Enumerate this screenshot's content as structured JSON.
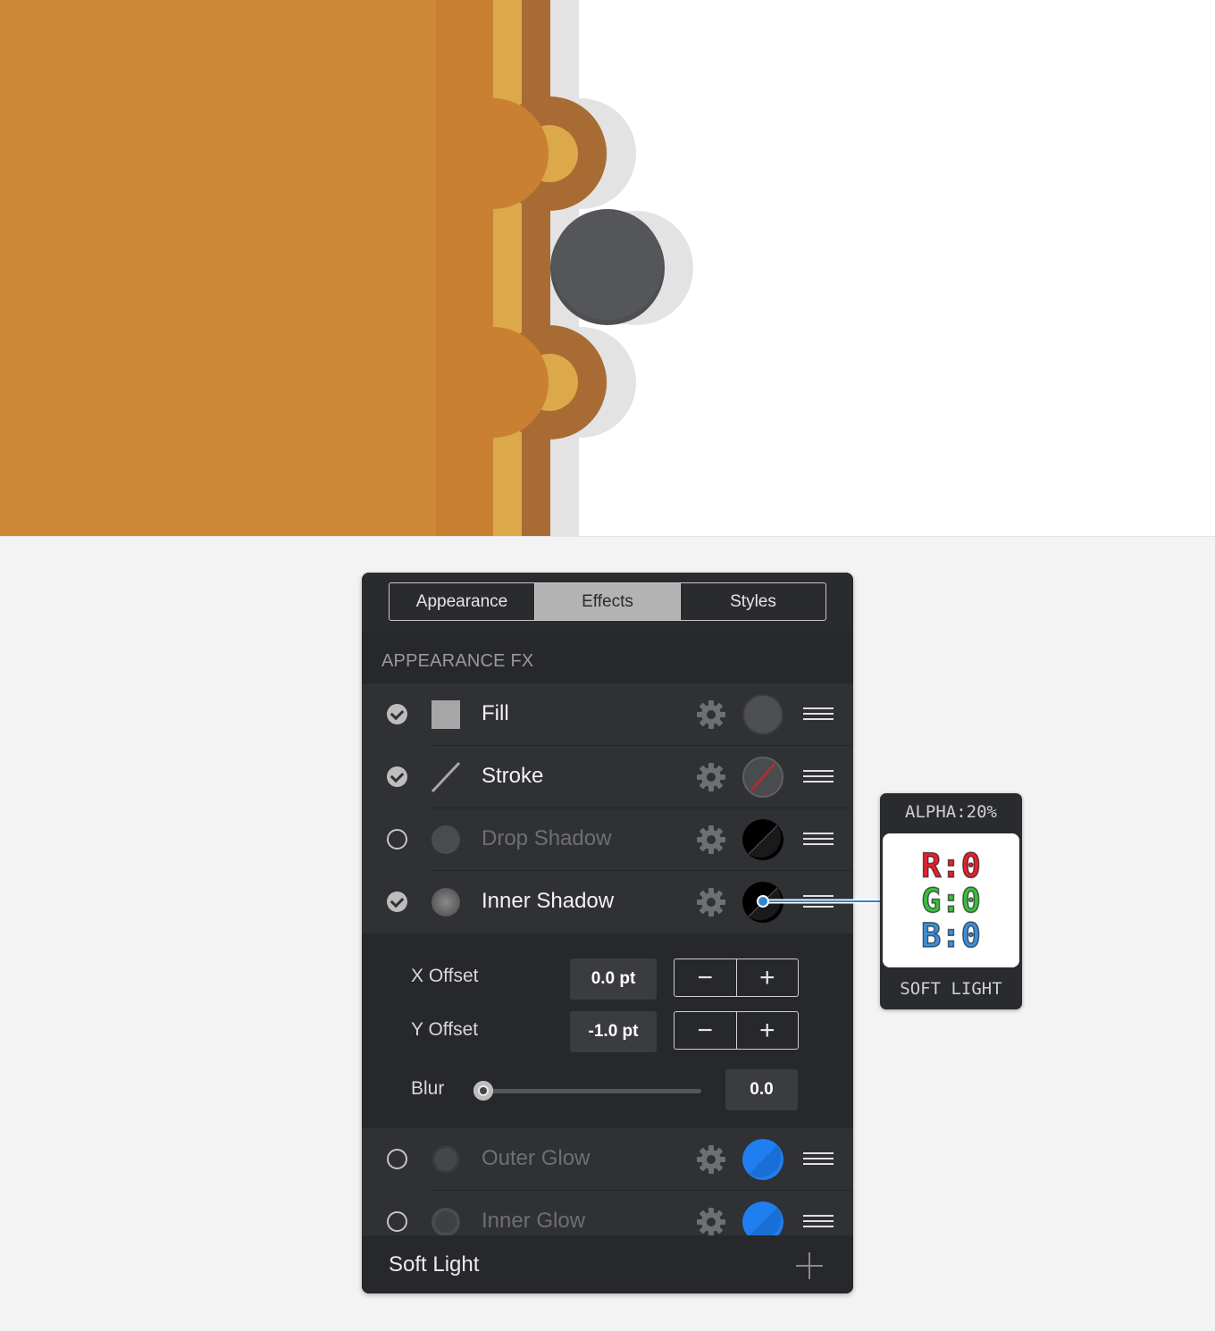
{
  "tabs": [
    {
      "label": "Appearance",
      "active": false
    },
    {
      "label": "Effects",
      "active": true
    },
    {
      "label": "Styles",
      "active": false
    }
  ],
  "section_title": "APPEARANCE FX",
  "effects": [
    {
      "label": "Fill",
      "enabled": true,
      "icon": "square-fill-icon",
      "swatch": "dark-gray"
    },
    {
      "label": "Stroke",
      "enabled": true,
      "icon": "stroke-line-icon",
      "swatch": "none-red-slash"
    },
    {
      "label": "Drop Shadow",
      "enabled": false,
      "icon": "drop-shadow-icon",
      "swatch": "black"
    },
    {
      "label": "Inner Shadow",
      "enabled": true,
      "icon": "inner-shadow-icon",
      "swatch": "black"
    },
    {
      "label": "Outer Glow",
      "enabled": false,
      "icon": "outer-glow-icon",
      "swatch": "blue"
    },
    {
      "label": "Inner Glow",
      "enabled": false,
      "icon": "inner-glow-icon",
      "swatch": "blue"
    }
  ],
  "inner_shadow": {
    "x_offset_label": "X Offset",
    "x_offset_value": "0.0 pt",
    "y_offset_label": "Y Offset",
    "y_offset_value": "-1.0 pt",
    "blur_label": "Blur",
    "blur_value": "0.0",
    "stepper_minus": "−",
    "stepper_plus": "+"
  },
  "footer": {
    "blend_mode": "Soft Light"
  },
  "tooltip": {
    "alpha": "ALPHA:20%",
    "r": "R:0",
    "g": "G:0",
    "b": "B:0",
    "blend": "SOFT LIGHT"
  },
  "colors": {
    "cover_orange": "#cf8836",
    "spine_light": "#dba94a",
    "spine_dark": "#a86b33",
    "ring_gray": "#4e4f52",
    "glow_blue": "#1f7ff0",
    "r_red": "#e0242f",
    "g_green": "#3dbb3f",
    "b_blue": "#3d8fdc"
  }
}
